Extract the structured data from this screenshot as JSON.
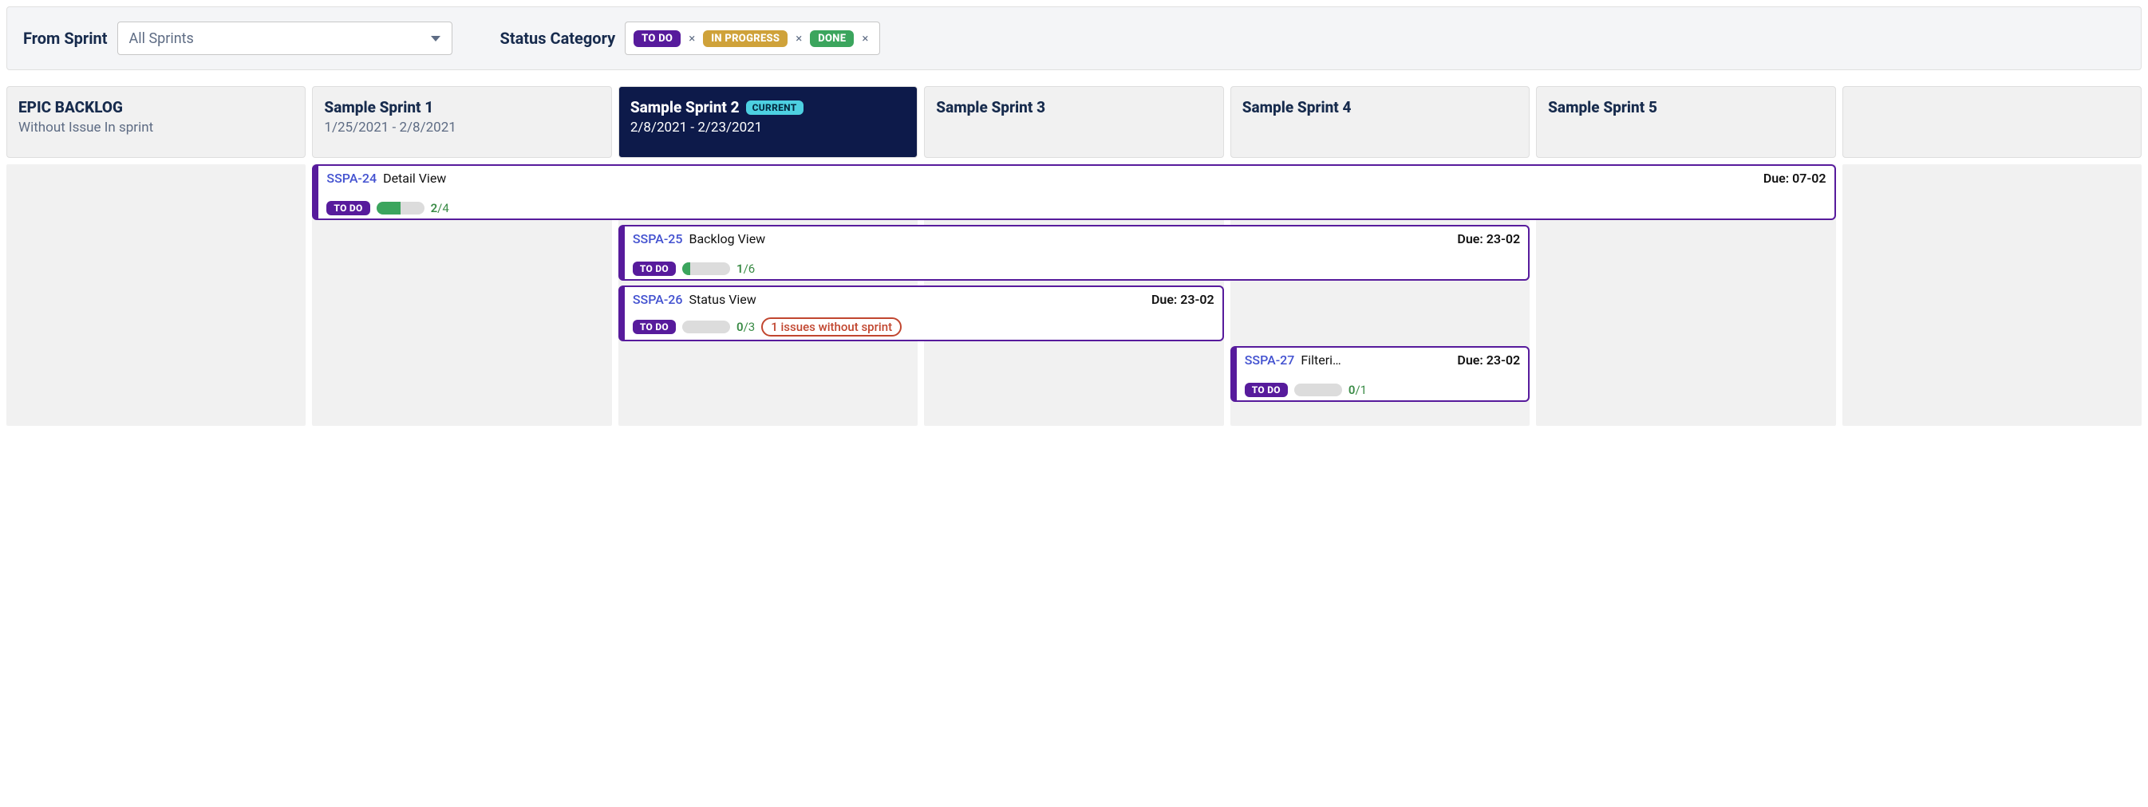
{
  "filters": {
    "from_sprint_label": "From Sprint",
    "from_sprint_value": "All Sprints",
    "status_category_label": "Status Category",
    "status_tags": [
      {
        "label": "TO DO",
        "css": "chip-todo"
      },
      {
        "label": "IN PROGRESS",
        "css": "chip-inprogress"
      },
      {
        "label": "DONE",
        "css": "chip-done"
      }
    ]
  },
  "columns": [
    {
      "title": "EPIC BACKLOG",
      "sub": "Without Issue In sprint",
      "current": false
    },
    {
      "title": "Sample Sprint 1",
      "sub": "1/25/2021 - 2/8/2021",
      "current": false
    },
    {
      "title": "Sample Sprint 2",
      "sub": "2/8/2021 - 2/23/2021",
      "current": true,
      "badge": "CURRENT"
    },
    {
      "title": "Sample Sprint 3",
      "sub": "",
      "current": false
    },
    {
      "title": "Sample Sprint 4",
      "sub": "",
      "current": false
    },
    {
      "title": "Sample Sprint 5",
      "sub": "",
      "current": false
    },
    {
      "title": "",
      "sub": "",
      "current": false
    }
  ],
  "cards": [
    {
      "key": "SSPA-24",
      "title": "Detail View",
      "due": "Due: 07-02",
      "status": "TO DO",
      "done": 2,
      "total": 4,
      "col_start": 2,
      "col_end": 7,
      "row": 1
    },
    {
      "key": "SSPA-25",
      "title": "Backlog View",
      "due": "Due: 23-02",
      "status": "TO DO",
      "done": 1,
      "total": 6,
      "col_start": 3,
      "col_end": 6,
      "row": 2
    },
    {
      "key": "SSPA-26",
      "title": "Status View",
      "due": "Due: 23-02",
      "status": "TO DO",
      "done": 0,
      "total": 3,
      "warning": "1 issues without sprint",
      "col_start": 3,
      "col_end": 5,
      "row": 3
    },
    {
      "key": "SSPA-27",
      "title": "Filteri…",
      "due": "Due: 23-02",
      "status": "TO DO",
      "done": 0,
      "total": 1,
      "col_start": 5,
      "col_end": 6,
      "row": 4
    }
  ]
}
